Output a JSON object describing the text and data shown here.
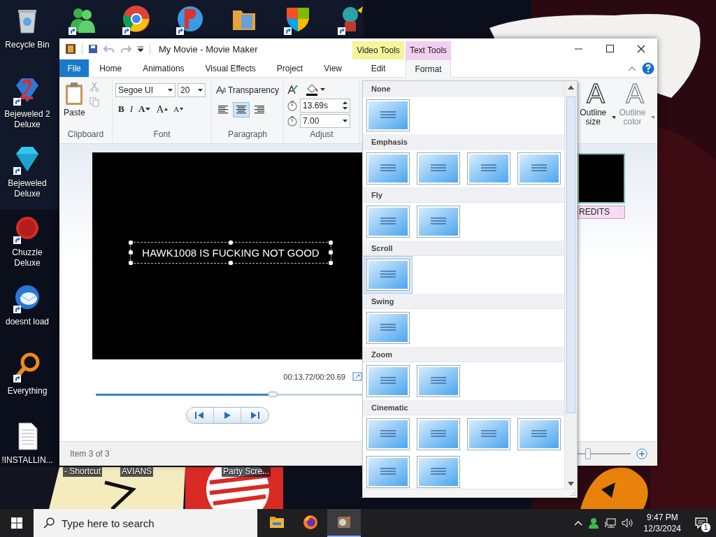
{
  "desktop": {
    "left_icons": [
      {
        "label": "Recycle Bin",
        "kind": "bin",
        "shortcut": false
      },
      {
        "label": "Bejeweled 2 Deluxe",
        "kind": "gem2",
        "shortcut": true
      },
      {
        "label": "Bejeweled Deluxe",
        "kind": "gem",
        "shortcut": true
      },
      {
        "label": "Chuzzle Deluxe",
        "kind": "fuzzy",
        "shortcut": true
      },
      {
        "label": "doesnt load",
        "kind": "bird",
        "shortcut": true
      },
      {
        "label": "Everything",
        "kind": "magnifier",
        "shortcut": true
      },
      {
        "label": "!INSTALLIN...",
        "kind": "document",
        "shortcut": false
      }
    ],
    "top_icons": [
      {
        "kind": "people",
        "shortcut": true
      },
      {
        "kind": "browser",
        "shortcut": true
      },
      {
        "kind": "ball",
        "shortcut": true
      },
      {
        "kind": "folder",
        "shortcut": false
      },
      {
        "kind": "shield",
        "shortcut": true
      },
      {
        "kind": "figure",
        "shortcut": true
      }
    ],
    "labels_below_window": [
      "- Shortcut",
      "AVIANS",
      "Party Scre..."
    ]
  },
  "window": {
    "title": "My Movie - Movie Maker",
    "contextual_tabs": [
      {
        "label": "Video Tools",
        "color": "#f4f49a"
      },
      {
        "label": "Text Tools",
        "color": "#f2cff0"
      }
    ],
    "tabs": [
      {
        "label": "File",
        "kind": "file",
        "selected": false
      },
      {
        "label": "Home",
        "kind": "main",
        "selected": false
      },
      {
        "label": "Animations",
        "kind": "main",
        "selected": false
      },
      {
        "label": "Visual Effects",
        "kind": "main",
        "selected": false
      },
      {
        "label": "Project",
        "kind": "main",
        "selected": false
      },
      {
        "label": "View",
        "kind": "main",
        "selected": false
      },
      {
        "label": "Edit",
        "kind": "context",
        "selected": false
      },
      {
        "label": "Format",
        "kind": "context",
        "selected": true
      }
    ],
    "clipboard": {
      "label": "Clipboard",
      "paste": "Paste"
    },
    "font": {
      "label": "Font",
      "family": "Segoe UI",
      "size": "20",
      "buttons": [
        {
          "glyph": "B",
          "kind": "bold"
        },
        {
          "glyph": "I",
          "kind": "italic"
        },
        {
          "glyph": "A",
          "kind": "color"
        },
        {
          "glyph": "A",
          "kind": "grow"
        },
        {
          "glyph": "A",
          "kind": "shrink"
        }
      ]
    },
    "paragraph": {
      "label": "Paragraph",
      "transparency": "Transparency",
      "alignments": [
        {
          "selected": false
        },
        {
          "selected": true
        },
        {
          "selected": false
        }
      ]
    },
    "adjust": {
      "label": "Adjust",
      "start_time": "13.69s",
      "duration": "7.00"
    },
    "outline": [
      {
        "glyph": "A",
        "label": "Outline size",
        "disabled": false
      },
      {
        "glyph": "A",
        "label": "Outline color",
        "disabled": true
      }
    ],
    "preview": {
      "caption": "HAWK1008 IS FUCKING NOT GOOD",
      "time": "00:13.72/00:20.69",
      "seek": {
        "level": 0.663
      }
    },
    "storyboard": {
      "caption": "REDITS"
    },
    "status_bar": {
      "text": "Item 3 of 3",
      "zoom": {
        "level": 0.22
      }
    }
  },
  "animation_gallery": {
    "sections": [
      {
        "title": "None",
        "items": [
          {
            "selected": false
          }
        ]
      },
      {
        "title": "Emphasis",
        "items": [
          {
            "selected": false
          },
          {
            "selected": false
          },
          {
            "selected": false
          },
          {
            "selected": false
          }
        ]
      },
      {
        "title": "Fly",
        "items": [
          {
            "selected": false
          },
          {
            "selected": false
          }
        ]
      },
      {
        "title": "Scroll",
        "items": [
          {
            "selected": true
          }
        ]
      },
      {
        "title": "Swing",
        "items": [
          {
            "selected": false
          }
        ]
      },
      {
        "title": "Zoom",
        "items": [
          {
            "selected": false
          },
          {
            "selected": false
          }
        ]
      },
      {
        "title": "Cinematic",
        "items": [
          {
            "selected": false
          },
          {
            "selected": false
          },
          {
            "selected": false
          },
          {
            "selected": false
          },
          {
            "selected": false
          },
          {
            "selected": false
          }
        ]
      }
    ]
  },
  "taskbar": {
    "search_placeholder": "Type here to search",
    "apps": [
      {
        "kind": "folder",
        "active": false
      },
      {
        "kind": "firefox",
        "active": false
      },
      {
        "kind": "moviemaker",
        "active": true
      }
    ],
    "time": "9:47 PM",
    "date": "12/3/2024",
    "notifications": "1"
  }
}
